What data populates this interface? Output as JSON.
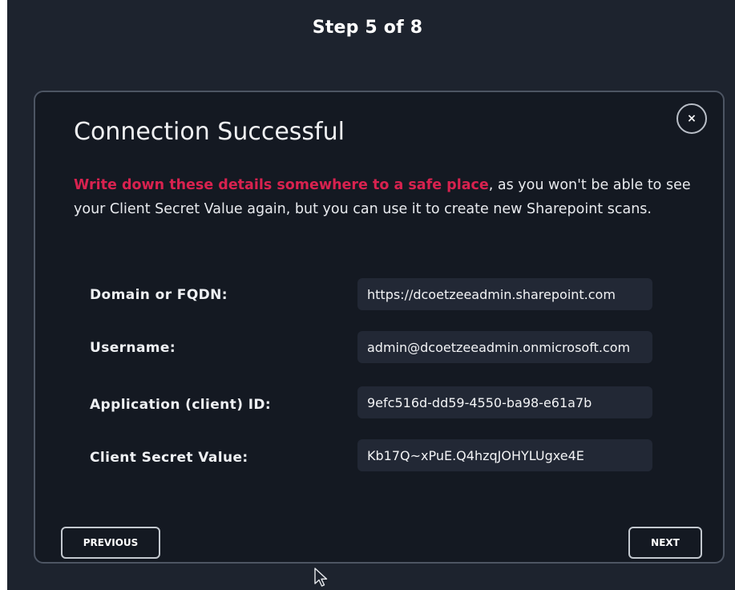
{
  "header": {
    "step_label": "Step 5 of  8"
  },
  "dialog": {
    "title": "Connection Successful",
    "close_label": "×",
    "message_highlight": "Write down these details somewhere to a safe place",
    "message_rest": ", as you won't be able to see your Client Secret Value again, but you can use it to create new Sharepoint scans.",
    "fields": [
      {
        "label": "Domain or FQDN:",
        "value": "https://dcoetzeeadmin.sharepoint.com"
      },
      {
        "label": "Username:",
        "value": "admin@dcoetzeeadmin.onmicrosoft.com"
      },
      {
        "label": "Application (client) ID:",
        "value": "9efc516d-dd59-4550-ba98-e61a7b"
      },
      {
        "label": "Client Secret Value:",
        "value": "Kb17Q~xPuE.Q4hzqJOHYLUgxe4E"
      }
    ],
    "previous_label": "PREVIOUS",
    "next_label": "NEXT"
  },
  "colors": {
    "page_background": "#1d232e",
    "dialog_background": "#141922",
    "highlight": "#d8224f",
    "field_background": "#222835"
  },
  "icons": {
    "close": "close-icon",
    "cursor": "mouse-pointer-icon"
  }
}
